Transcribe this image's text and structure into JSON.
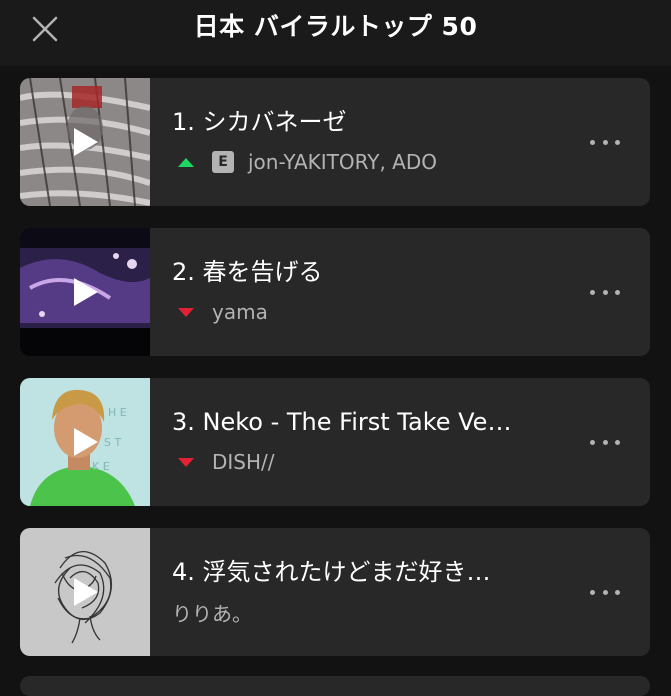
{
  "header": {
    "title": "日本 バイラルトップ 50",
    "close_icon": "close-icon"
  },
  "colors": {
    "background": "#121212",
    "card": "#282828",
    "trend_up": "#1ed760",
    "trend_down": "#e22134",
    "secondary_text": "#b3b3b3"
  },
  "tracks": [
    {
      "title": "1. シカバネーゼ",
      "artist": "jon-YAKITORY, ADO",
      "trend": "up",
      "explicit": true,
      "explicit_label": "E"
    },
    {
      "title": "2. 春を告げる",
      "artist": "yama",
      "trend": "down",
      "explicit": false
    },
    {
      "title": "3. Neko - The First Take Ve…",
      "artist": "DISH//",
      "trend": "down",
      "explicit": false
    },
    {
      "title": "4. 浮気されたけどまだ好き…",
      "artist": "りりあ。",
      "trend": "none",
      "explicit": false
    }
  ]
}
